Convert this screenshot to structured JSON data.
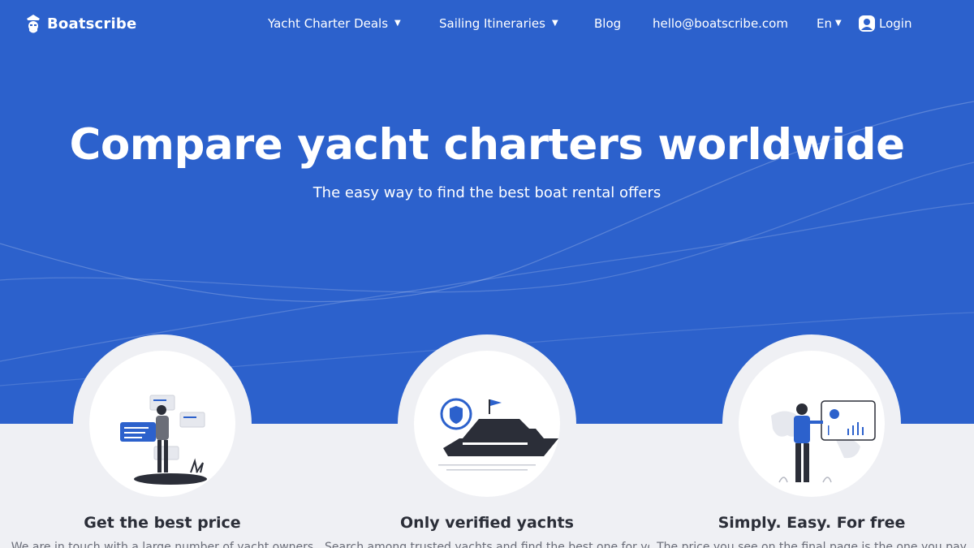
{
  "brand": {
    "name": "Boatscribe"
  },
  "nav": {
    "items": [
      {
        "label": "Yacht Charter Deals",
        "dropdown": true
      },
      {
        "label": "Sailing Itineraries",
        "dropdown": true
      },
      {
        "label": "Blog",
        "dropdown": false
      },
      {
        "label": "hello@boatscribe.com",
        "dropdown": false
      }
    ],
    "language": "En",
    "login": "Login"
  },
  "hero": {
    "title": "Compare yacht charters worldwide",
    "subtitle": "The easy way to find the best boat rental offers"
  },
  "features": [
    {
      "title": "Get the best price",
      "text": "We are in touch with a large number of yacht owners",
      "icon": "person-offers-illustration"
    },
    {
      "title": "Only verified yachts",
      "text": "Search among trusted yachts and find the best one for you",
      "icon": "verified-yacht-illustration"
    },
    {
      "title": "Simply. Easy. For free",
      "text": "The price you see on the final page is the one you pay",
      "icon": "person-dashboard-illustration"
    }
  ],
  "colors": {
    "primary": "#2c61cc",
    "background": "#eff0f4",
    "text_dark": "#2b2e38"
  }
}
